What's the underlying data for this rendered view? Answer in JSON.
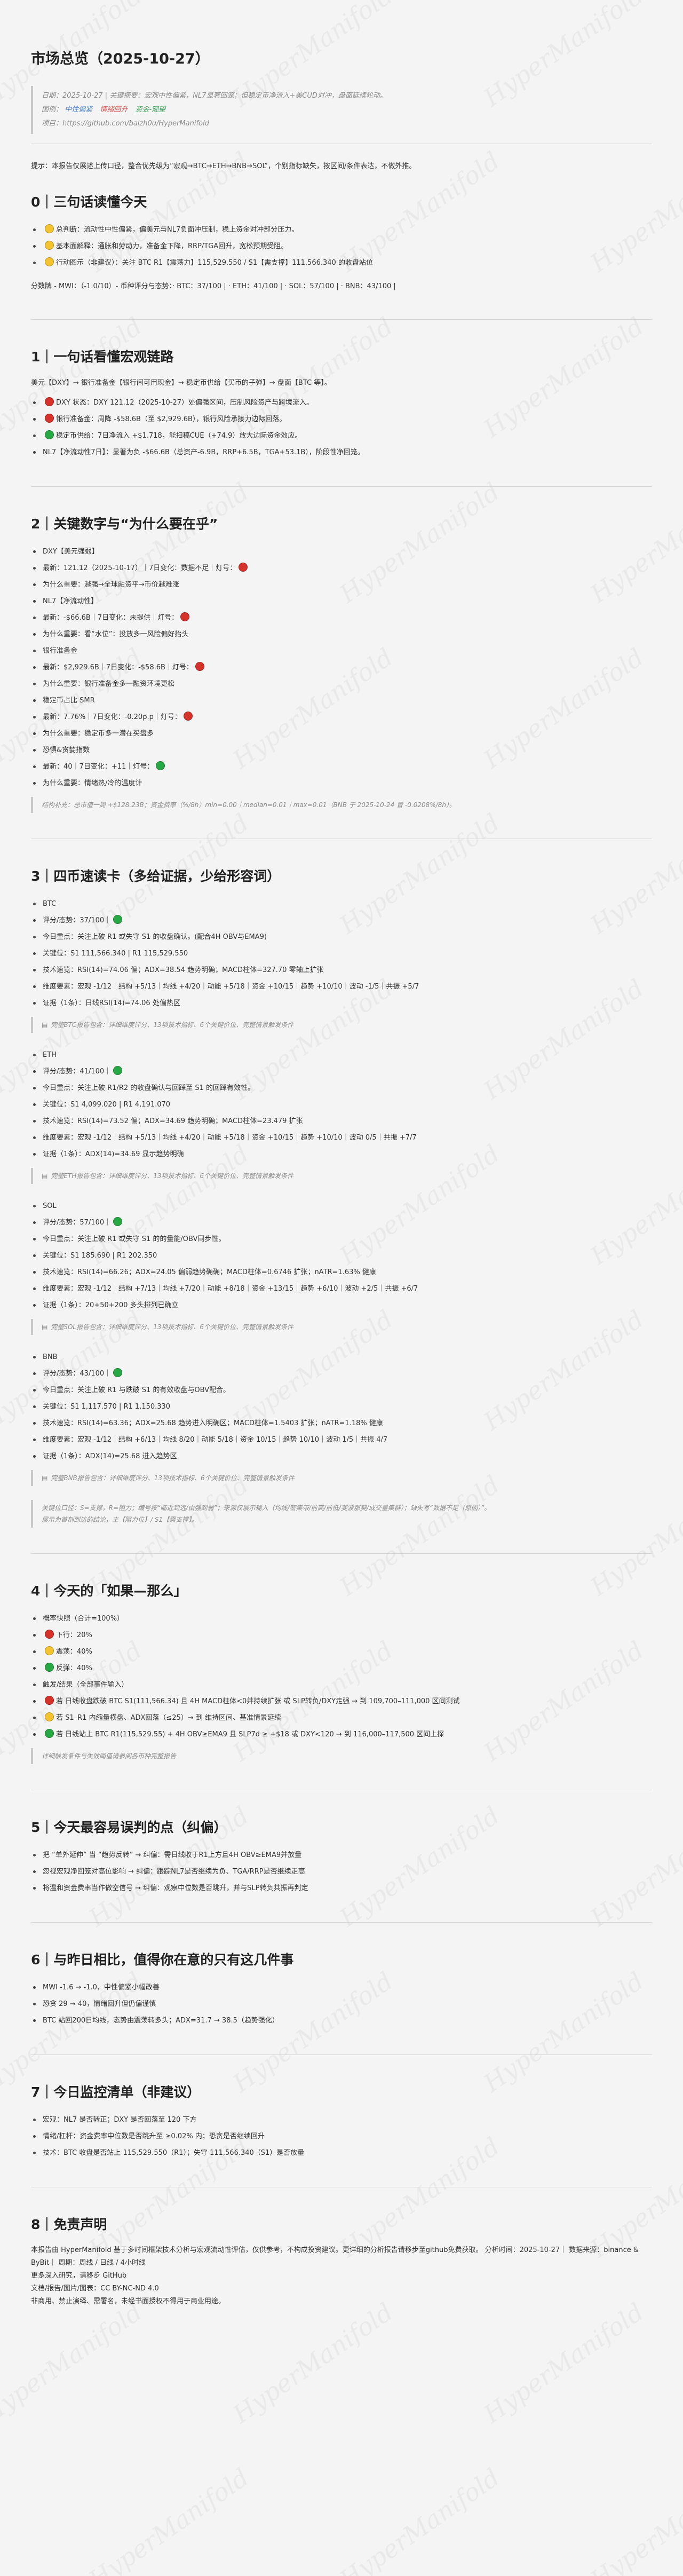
{
  "title": "市场总览（2025-10-27）",
  "meta": {
    "line1": "日期：2025-10-27 | 关键摘要：宏观中性偏紧，NL7显著回笼；但稳定币净流入+美CUD对冲，盘面延续轮动。",
    "line2_prefix": "图例：",
    "legend_a": "中性偏紧",
    "legend_b": "情绪回升",
    "legend_c": "资金-观望",
    "line3": "项目：https://github.com/baizh0u/HyperManifold"
  },
  "intro": "提示：本报告仅展述上传口径，整合优先级为“宏观→BTC→ETH→BNB→SOL”，个别指标缺失，按区间/条件表达，不做外推。",
  "s0": {
    "title": "0｜三句话读懂今天",
    "items": [
      "总判断：流动性中性偏紧，偏美元与NL7负面冲压制，稳上资金对冲部分压力。",
      "基本面解释：通胀和劳动力，准备金下降，RRP/TGA回升，宽松预期受阻。",
      "行动图示（非建议）：关注 BTC R1【震荡力】115,529.550 / S1【需支撑】111,566.340 的收盘站位"
    ],
    "scores": "分数牌 - MWI：（-1.0/10）- 币种评分与态势：· BTC：37/100 | · ETH：41/100 | · SOL：57/100 | · BNB：43/100 |"
  },
  "s1": {
    "title": "1｜一句话看懂宏观链路",
    "lead": "美元【DXY】→ 银行准备金【银行间可用现金】→ 稳定币供给【买币的子弹】→ 盘面【BTC 等】。",
    "items": [
      "DXY 状态：DXY 121.12（2025-10-27）处偏强区间，压制风险资产与跨境流入。",
      "银行准备金：周降 -$58.6B（至 $2,929.6B），银行风险承接力边际回落。",
      "稳定币供给：7日净流入 +$1.718，能扫稿CUE（+74.9）放大边际资金效应。",
      "NL7【净流动性7日】：显著为负 -$66.6B（总资产-6.9B，RRP+6.5B，TGA+53.1B），阶段性净回笼。"
    ]
  },
  "s2": {
    "title": "2｜关键数字与“为什么要在乎”",
    "items": [
      "DXY【美元强弱】",
      "最新：121.12（2025-10-17）｜7日变化：数据不足｜灯号：",
      "为什么重要：越强→全球融资平→币价越难涨",
      "NL7【净流动性】",
      "最新：-$66.6B｜7日变化：未提供｜灯号：",
      "为什么重要：看“水位”：投放多一风险偏好抬头",
      "银行准备金",
      "最新：$2,929.6B｜7日变化：-$58.6B｜灯号：",
      "为什么重要：银行准备金多一融资环境更松",
      "稳定币占比 SMR",
      "最新：7.76%｜7日变化：-0.20p.p｜灯号：",
      "为什么重要：稳定币多一潜在买盘多",
      "恐惧&贪婪指数",
      "最新：40｜7日变化：+11｜灯号：",
      "为什么重要：情绪热/冷的温度计"
    ],
    "dots": [
      "",
      "red",
      "",
      "",
      "red",
      "",
      "",
      "red",
      "",
      "",
      "red",
      "",
      "",
      "green",
      ""
    ],
    "note": "结构补充：总市值一周 +$128.23B；资金费率（%/8h）min=0.00｜median=0.01｜max=0.01（BNB 于 2025-10-24 曾 -0.0208%/8h）。"
  },
  "s3": {
    "title": "3｜四币速读卡（多给证据，少给形容词）",
    "coins": [
      {
        "name": "BTC",
        "score": "评分/态势：37/100｜",
        "dot": "green",
        "rows": [
          "今日重点：关注上破 R1 或失守 S1 的收盘确认。(配合4H OBV与EMA9)",
          "关键位：S1 111,566.340 | R1 115,529.550",
          "技术速览：RSI(14)=74.06 偏；ADX=38.54 趋势明确；MACD柱体=327.70 零轴上扩张",
          "维度要素：宏观 -1/12｜结构 +5/13｜均线 +4/20｜动能 +5/18｜资金 +10/15｜趋势 +10/10｜波动 -1/5｜共振 +5/7",
          "证据（1条）：日线RSI(14)=74.06 处偏热区"
        ],
        "note": "完整BTC报告包含：详细维度评分、13项技术指标、6个关键价位、完整情景触发条件"
      },
      {
        "name": "ETH",
        "score": "评分/态势：41/100｜",
        "dot": "green",
        "rows": [
          "今日重点：关注上破 R1/R2 的收盘确认与回踩至 S1 的回踩有效性。",
          "关键位：S1 4,099.020 | R1 4,191.070",
          "技术速览：RSI(14)=73.52 偏；ADX=34.69 趋势明确；MACD柱体=23.479 扩张",
          "维度要素：宏观 -1/12｜结构 +5/13｜均线 +4/20｜动能 +5/18｜资金 +10/15｜趋势 +10/10｜波动 0/5｜共振 +7/7",
          "证据（1条）：ADX(14)=34.69 显示趋势明确"
        ],
        "note": "完整ETH报告包含：详细维度评分、13项技术指标、6个关键价位、完整情景触发条件"
      },
      {
        "name": "SOL",
        "score": "评分/态势：57/100｜",
        "dot": "green",
        "rows": [
          "今日重点：关注上破 R1 或失守 S1 的的量能/OBV同步性。",
          "关键位：S1 185.690 | R1 202.350",
          "技术速览：RSI(14)=66.26；ADX=24.05 偏弱趋势确确；MACD柱体=0.6746 扩张；nATR=1.63% 健康",
          "维度要素：宏观 -1/12｜结构 +7/13｜均线 +7/20｜动能 +8/18｜资金 +13/15｜趋势 +6/10｜波动 +2/5｜共振 +6/7",
          "证据（1条）：20+50+200 多头排列已确立"
        ],
        "note": "完整SOL报告包含：详细维度评分、13项技术指标、6个关键价位、完整情景触发条件"
      },
      {
        "name": "BNB",
        "score": "评分/态势：43/100｜",
        "dot": "green",
        "rows": [
          "今日重点：关注上破 R1 与跌破 S1 的有效收盘与OBV配合。",
          "关键位：S1 1,117.570 | R1 1,150.330",
          "技术速览：RSI(14)=63.36；ADX=25.68 趋势进入明确区；MACD柱体=1.5403 扩张；nATR=1.18% 健康",
          "维度要素：宏观 -1/12｜结构 +6/13｜均线 8/20｜动能 5/18｜资金 10/15｜趋势 10/10｜波动 1/5｜共振 4/7",
          "证据（1条）：ADX(14)=25.68 进入趋势区"
        ],
        "note": "完整BNB报告包含：详细维度评分、13项技术指标、6个关键价位、完整情景触发条件"
      }
    ],
    "footer": "关键位口径：S=支撑，R=阻力；编号按“临近到远/由强到弱”；来源仅展示输入（均线/密集带/前高/前低/斐波那契/成交量集群）；缺失写“数据不足（原因）”。",
    "footer2": "展示为首刻到达的结论，主【阻力位】/ S1【需支撑】。"
  },
  "s4": {
    "title": "4｜今天的「如果—那么」",
    "items": [
      "概率快照（合计=100%）",
      "下行：20%",
      "震荡：40%",
      "反弹：40%",
      "触发/结果（全部事件输入）",
      "若 日线收盘跌破 BTC S1(111,566.34) 且 4H MACD柱体<0并持续扩张 或 SLP转负/DXY走强 → 到 109,700–111,000 区间测试",
      "若 S1–R1 内缩量横盘、ADX回落（≤25）→ 到 维持区间、基准情景延续",
      "若 日线站上 BTC R1(115,529.55) + 4H OBV≥EMA9 且 SLP7d ≥ +$18 或 DXY<120 → 到 116,000–117,500 区间上探"
    ],
    "dots": [
      "",
      "red",
      "yellow",
      "green",
      "",
      "red",
      "yellow",
      "green"
    ],
    "note": "详细触发条件与失效阈值请参阅各币种完整报告"
  },
  "s5": {
    "title": "5｜今天最容易误判的点（纠偏）",
    "items": [
      "把 “单外延伸” 当 “趋势反转” → 纠偏：需日线收于R1上方且4H OBV≥EMA9并放量",
      "忽视宏观净回笼对高位影响 → 纠偏：跟踪NL7是否继续为负、TGA/RRP是否继续走高",
      "将温和资金费率当作做空信号 → 纠偏：观察中位数是否跳升，并与SLP转负共振再判定"
    ]
  },
  "s6": {
    "title": "6｜与昨日相比，值得你在意的只有这几件事",
    "items": [
      "MWI -1.6 → -1.0，中性偏紧小幅改善",
      "恐贪 29 → 40，情绪回升但仍偏谨慎",
      "BTC 站回200日均线，态势由震荡转多头；ADX=31.7 → 38.5（趋势强化）"
    ]
  },
  "s7": {
    "title": "7｜今日监控清单（非建议）",
    "items": [
      "宏观：NL7 是否转正；DXY 是否回落至 120 下方",
      "情绪/杠杆：资金费率中位数是否跳升至 ≥0.02% 内；恐贪是否继续回升",
      "技术：BTC 收盘是否站上 115,529.550（R1）；失守 111,566.340（S1）是否放量"
    ]
  },
  "s8": {
    "title": "8｜免责声明",
    "lines": [
      "本报告由 HyperManifold 基于多时间框架技术分析与宏观流动性评估，仅供参考，不构成投资建议。更详细的分析报告请移步至github免费获取。 分析时间：2025-10-27｜ 数据来源：binance & ByBit｜ 周期：周线 / 日线 / 4小时线",
      "更多深入研究，请移步 GitHub",
      "文档/报告/图片/图表：CC BY-NC-ND 4.0",
      "非商用、禁止演绎、需署名，未经书面授权不得用于商业用途。"
    ]
  },
  "watermark_text": "HyperManifold"
}
